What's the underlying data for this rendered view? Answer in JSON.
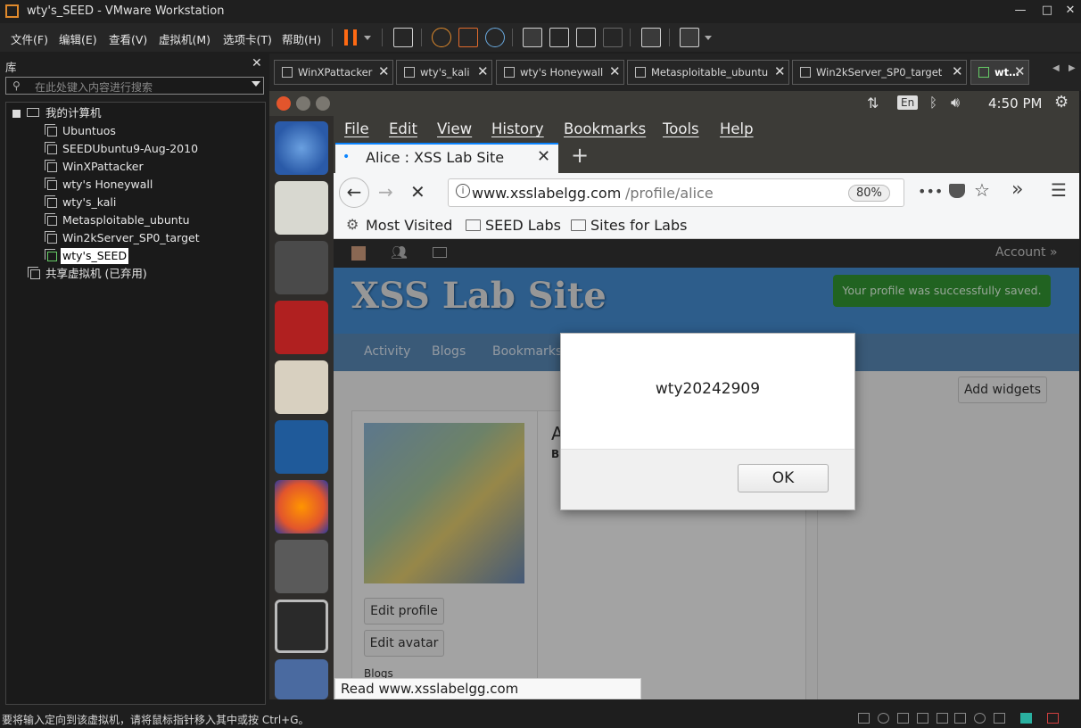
{
  "window": {
    "title": "wty's_SEED - VMware Workstation",
    "min": "—",
    "max": "□",
    "close": "✕"
  },
  "menu": [
    "文件(F)",
    "编辑(E)",
    "查看(V)",
    "虚拟机(M)",
    "选项卡(T)",
    "帮助(H)"
  ],
  "library": {
    "header": "库",
    "close": "✕",
    "search_placeholder": "在此处键入内容进行搜索",
    "root": "我的计算机",
    "vms": [
      "Ubuntuos",
      "SEEDUbuntu9-Aug-2010",
      "WinXPattacker",
      "wty's Honeywall",
      "wty's_kali",
      "Metasploitable_ubuntu",
      "Win2kServer_SP0_target",
      "wty's_SEED"
    ],
    "shared": "共享虚拟机 (已弃用)"
  },
  "vm_tabs": [
    "WinXPattacker",
    "wty's_kali",
    "wty's Honeywall",
    "Metasploitable_ubuntu",
    "Win2kServer_SP0_target",
    "wt…"
  ],
  "guest": {
    "lang": "En",
    "time": "4:50 PM",
    "firefox": {
      "menu": [
        "File",
        "Edit",
        "View",
        "History",
        "Bookmarks",
        "Tools",
        "Help"
      ],
      "tab_title": "Alice : XSS Lab Site",
      "url_host": "www.xsslabelgg.com",
      "url_path": "/profile/alice",
      "zoom": "80%",
      "bookmarks": [
        "Most Visited",
        "SEED Labs",
        "Sites for Labs"
      ]
    },
    "page": {
      "account": "Account »",
      "site_title": "XSS Lab Site",
      "saved_msg": "Your profile was successfully saved.",
      "nav": [
        "Activity",
        "Blogs",
        "Bookmarks"
      ],
      "add_widgets": "Add widgets",
      "edit_profile": "Edit profile",
      "edit_avatar": "Edit avatar",
      "blogs": "Blogs",
      "partial_a": "A",
      "partial_b": "B"
    },
    "alert": {
      "message": "wty20242909",
      "ok": "OK"
    },
    "status_text": "Read www.xsslabelgg.com"
  },
  "statusbar": {
    "text": "要将输入定向到该虚拟机，请将鼠标指针移入其中或按 Ctrl+G。"
  }
}
